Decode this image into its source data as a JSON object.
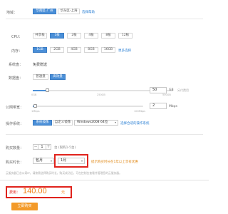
{
  "region": {
    "label": "地域：",
    "options": [
      "华南区-广州",
      "华东区-上海"
    ],
    "selected_index": 0,
    "more_link": "选择帮助"
  },
  "cpu": {
    "label": "CPU：",
    "options": [
      "共享核",
      "1核",
      "2核",
      "4核",
      "8核",
      "12核"
    ],
    "selected_index": 1
  },
  "memory": {
    "label": "内存：",
    "options": [
      "1GB",
      "2GB",
      "4GB",
      "8GB",
      "16GB"
    ],
    "selected_index": 0,
    "more_link": "更多选择"
  },
  "system_disk": {
    "label": "系统盘：",
    "value": "免费赠送"
  },
  "data_disk": {
    "label": "数据盘：",
    "options": [
      "普通盘",
      "高效盘"
    ],
    "selected_index": 1,
    "ticks": [
      "0GB",
      "250GB",
      "500GB"
    ],
    "input_value": "50",
    "unit": "GB",
    "hint": "另付费用",
    "level_gb": 50,
    "max_gb": 500
  },
  "bandwidth": {
    "label": "公网带宽：",
    "ticks": [
      "1Mbps",
      "100Mbps"
    ],
    "input_value": "2",
    "unit": "Mbps",
    "level_mbps": 2,
    "max_mbps": 100
  },
  "os": {
    "label": "操作系统：",
    "tabs": [
      "系统镜像",
      "自定义镜像"
    ],
    "selected_index": 0,
    "select_value": "Windows2008 64位",
    "help_link": "选择合适的操作系统"
  },
  "quantity": {
    "label": "购买数量：",
    "value": "1",
    "note": "台 (限购1-5台)"
  },
  "duration": {
    "label": "购买时长：",
    "period_value": "包月",
    "count_value": "1月",
    "note": "提示购买时长在1年以上享有优惠"
  },
  "footnote": "云服务器已含公网IP，请按需选择购买时长，购买成功后，可在控制台查看并管理您的云服务器。",
  "price": {
    "label": "费用：",
    "value": "140.00",
    "unit": "元"
  },
  "buy_button": "立即购买",
  "colors": {
    "accent": "#4a8fd8",
    "price": "#f07d12",
    "highlight": "#e0231c",
    "buy": "#f39a29"
  }
}
